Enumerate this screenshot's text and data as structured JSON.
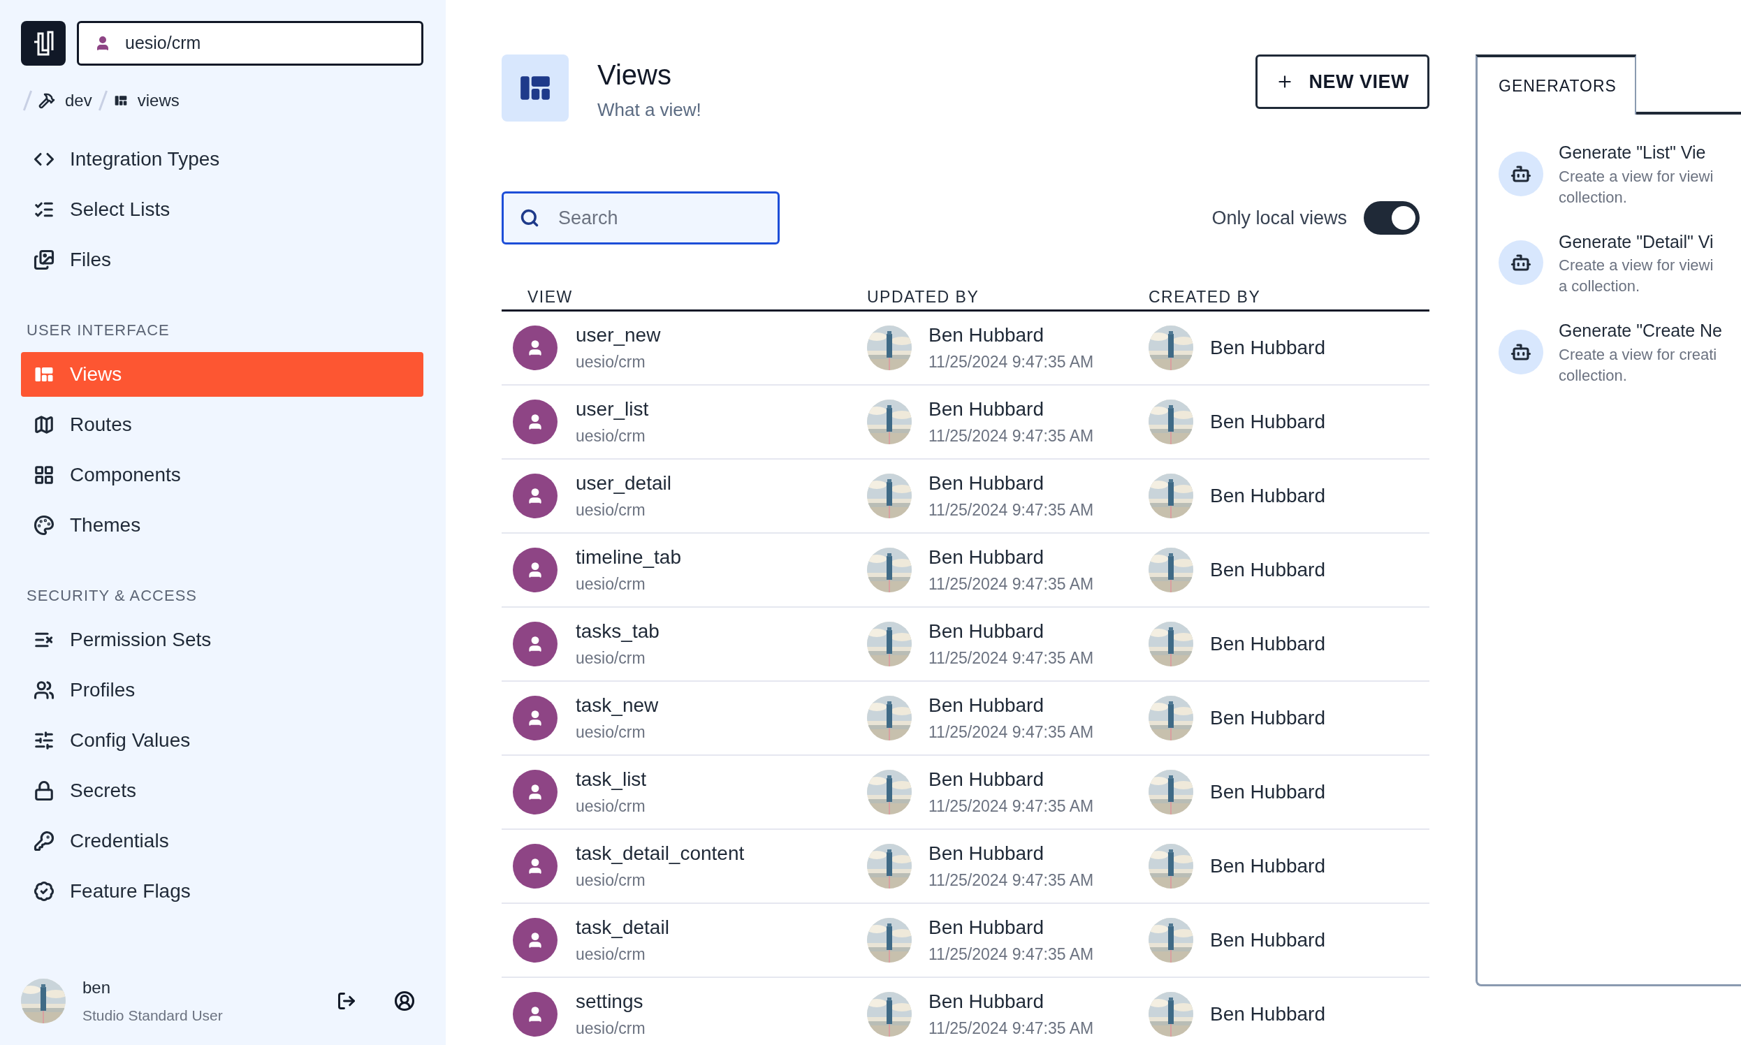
{
  "sidebar": {
    "app_select": {
      "value": "uesio/crm"
    },
    "breadcrumb": [
      {
        "kind": "tools",
        "label": "dev"
      },
      {
        "kind": "views",
        "label": "views"
      }
    ],
    "sections": [
      {
        "items": [
          {
            "label": "Integration Types",
            "selected": false
          },
          {
            "label": "Select Lists",
            "selected": false
          },
          {
            "label": "Files",
            "selected": false
          }
        ]
      },
      {
        "heading": "USER INTERFACE",
        "items": [
          {
            "label": "Views",
            "selected": true
          },
          {
            "label": "Routes",
            "selected": false
          },
          {
            "label": "Components",
            "selected": false
          },
          {
            "label": "Themes",
            "selected": false
          }
        ]
      },
      {
        "heading": "SECURITY & ACCESS",
        "items": [
          {
            "label": "Permission Sets",
            "selected": false
          },
          {
            "label": "Profiles",
            "selected": false
          },
          {
            "label": "Config Values",
            "selected": false
          },
          {
            "label": "Secrets",
            "selected": false
          },
          {
            "label": "Credentials",
            "selected": false
          },
          {
            "label": "Feature Flags",
            "selected": false
          }
        ]
      }
    ],
    "user": {
      "name": "ben",
      "role": "Studio Standard User"
    }
  },
  "header": {
    "title": "Views",
    "subtitle": "What a view!",
    "new_button": "NEW VIEW"
  },
  "search": {
    "placeholder": "Search"
  },
  "filter": {
    "label": "Only local views",
    "on": true
  },
  "table": {
    "columns": [
      "VIEW",
      "UPDATED BY",
      "CREATED BY"
    ],
    "rows": [
      {
        "name": "user_new",
        "namespace": "uesio/crm",
        "updated_by": "Ben Hubbard",
        "updated_at": "11/25/2024 9:47:35 AM",
        "created_by": "Ben Hubbard"
      },
      {
        "name": "user_list",
        "namespace": "uesio/crm",
        "updated_by": "Ben Hubbard",
        "updated_at": "11/25/2024 9:47:35 AM",
        "created_by": "Ben Hubbard"
      },
      {
        "name": "user_detail",
        "namespace": "uesio/crm",
        "updated_by": "Ben Hubbard",
        "updated_at": "11/25/2024 9:47:35 AM",
        "created_by": "Ben Hubbard"
      },
      {
        "name": "timeline_tab",
        "namespace": "uesio/crm",
        "updated_by": "Ben Hubbard",
        "updated_at": "11/25/2024 9:47:35 AM",
        "created_by": "Ben Hubbard"
      },
      {
        "name": "tasks_tab",
        "namespace": "uesio/crm",
        "updated_by": "Ben Hubbard",
        "updated_at": "11/25/2024 9:47:35 AM",
        "created_by": "Ben Hubbard"
      },
      {
        "name": "task_new",
        "namespace": "uesio/crm",
        "updated_by": "Ben Hubbard",
        "updated_at": "11/25/2024 9:47:35 AM",
        "created_by": "Ben Hubbard"
      },
      {
        "name": "task_list",
        "namespace": "uesio/crm",
        "updated_by": "Ben Hubbard",
        "updated_at": "11/25/2024 9:47:35 AM",
        "created_by": "Ben Hubbard"
      },
      {
        "name": "task_detail_content",
        "namespace": "uesio/crm",
        "updated_by": "Ben Hubbard",
        "updated_at": "11/25/2024 9:47:35 AM",
        "created_by": "Ben Hubbard"
      },
      {
        "name": "task_detail",
        "namespace": "uesio/crm",
        "updated_by": "Ben Hubbard",
        "updated_at": "11/25/2024 9:47:35 AM",
        "created_by": "Ben Hubbard"
      },
      {
        "name": "settings",
        "namespace": "uesio/crm",
        "updated_by": "Ben Hubbard",
        "updated_at": "11/25/2024 9:47:35 AM",
        "created_by": "Ben Hubbard"
      }
    ]
  },
  "generators": {
    "tab": "GENERATORS",
    "items": [
      {
        "title": "Generate \"List\" Vie",
        "description_lines": [
          "Create a view for viewi",
          "collection."
        ]
      },
      {
        "title": "Generate \"Detail\" Vi",
        "description_lines": [
          "Create a view for viewi",
          "a collection."
        ]
      },
      {
        "title": "Generate \"Create Ne",
        "description_lines": [
          "Create a view for creati",
          "collection."
        ]
      }
    ]
  }
}
